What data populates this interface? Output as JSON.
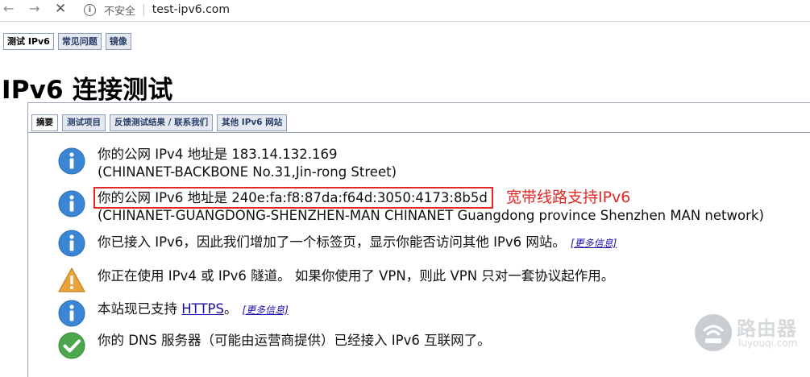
{
  "browser": {
    "security_label": "不安全",
    "separator": "|",
    "url": "test-ipv6.com"
  },
  "top_tabs": [
    "测试 IPv6",
    "常见问题",
    "镜像"
  ],
  "page_title": "IPv6 连接测试",
  "inner_tabs": [
    "摘要",
    "测试项目",
    "反馈测试结果 / 联系我们",
    "其他 IPv6 网站"
  ],
  "results": [
    {
      "status": "info",
      "line1": "你的公网 IPv4 地址是 183.14.132.169",
      "line2": "(CHINANET-BACKBONE No.31,Jin-rong Street)"
    },
    {
      "status": "info",
      "line1": "你的公网 IPv6 地址是 240e:fa:f8:87da:f64d:3050:4173:8b5d",
      "line2": "(CHINANET-GUANGDONG-SHENZHEN-MAN CHINANET Guangdong province Shenzhen MAN network)"
    },
    {
      "status": "info",
      "text": "你已接入 IPv6，因此我们增加了一个标签页，显示你能否访问其他 IPv6 网站。",
      "more": "[更多信息]"
    },
    {
      "status": "warning",
      "text": "你正在使用 IPv4 或 IPv6 隧道。 如果你使用了 VPN，则此 VPN 只对一套协议起作用。"
    },
    {
      "status": "info",
      "text_before": "本站现已支持 ",
      "link": "HTTPS",
      "text_after": "。",
      "more": "[更多信息]"
    },
    {
      "status": "ok",
      "text": "你的 DNS 服务器（可能由运营商提供）已经接入 IPv6 互联网了。"
    }
  ],
  "annotation": "宽带线路支持IPv6",
  "colors": {
    "info_blue": "#3a86d4",
    "warning_orange": "#e8a33a",
    "ok_green": "#4ca64c",
    "annotation_red": "#e32626"
  },
  "watermark": {
    "cn": "路由器",
    "en": "luyouqi.com"
  }
}
